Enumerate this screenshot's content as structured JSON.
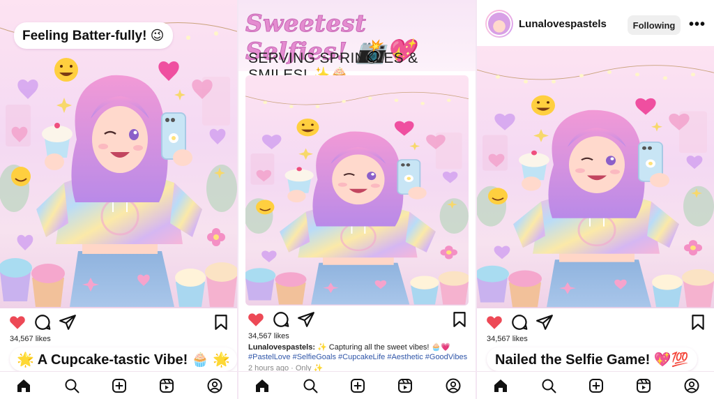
{
  "colors": {
    "accent_pink": "#e48cd0",
    "heart_red": "#ed4956",
    "link_blue": "#2f55a8"
  },
  "panel1": {
    "top_caption": "Feeling Batter-fully! 😉",
    "likes": "34,567 likes",
    "bottom_caption": "🌟 A Cupcake-tastic Vibe! 🧁 🌟"
  },
  "panel2": {
    "title": "Sweetest Selfies! 📸💖",
    "subtitle": "SERVING SPRINKLES & SMILES! ✨🧁",
    "likes": "34,567 likes",
    "username": "Lunalovespastels:",
    "caption": "✨ Capturing all the sweet vibes! 🧁💗",
    "hashtags": "#PastelLove #SelfieGoals #CupcakeLife #Aesthetic #GoodVibes",
    "time": "2 hours ago · Only ✨"
  },
  "panel3": {
    "username": "Lunalovespastels",
    "follow_label": "Following",
    "more_label": "•••",
    "likes": "34,567 likes",
    "bottom_caption": "Nailed the Selfie Game! 💖💯"
  },
  "icons": {
    "actions": [
      "heart-filled-icon",
      "comment-icon",
      "share-icon",
      "bookmark-icon"
    ],
    "nav": [
      "home-icon",
      "search-icon",
      "create-icon",
      "reels-icon",
      "profile-icon"
    ]
  }
}
